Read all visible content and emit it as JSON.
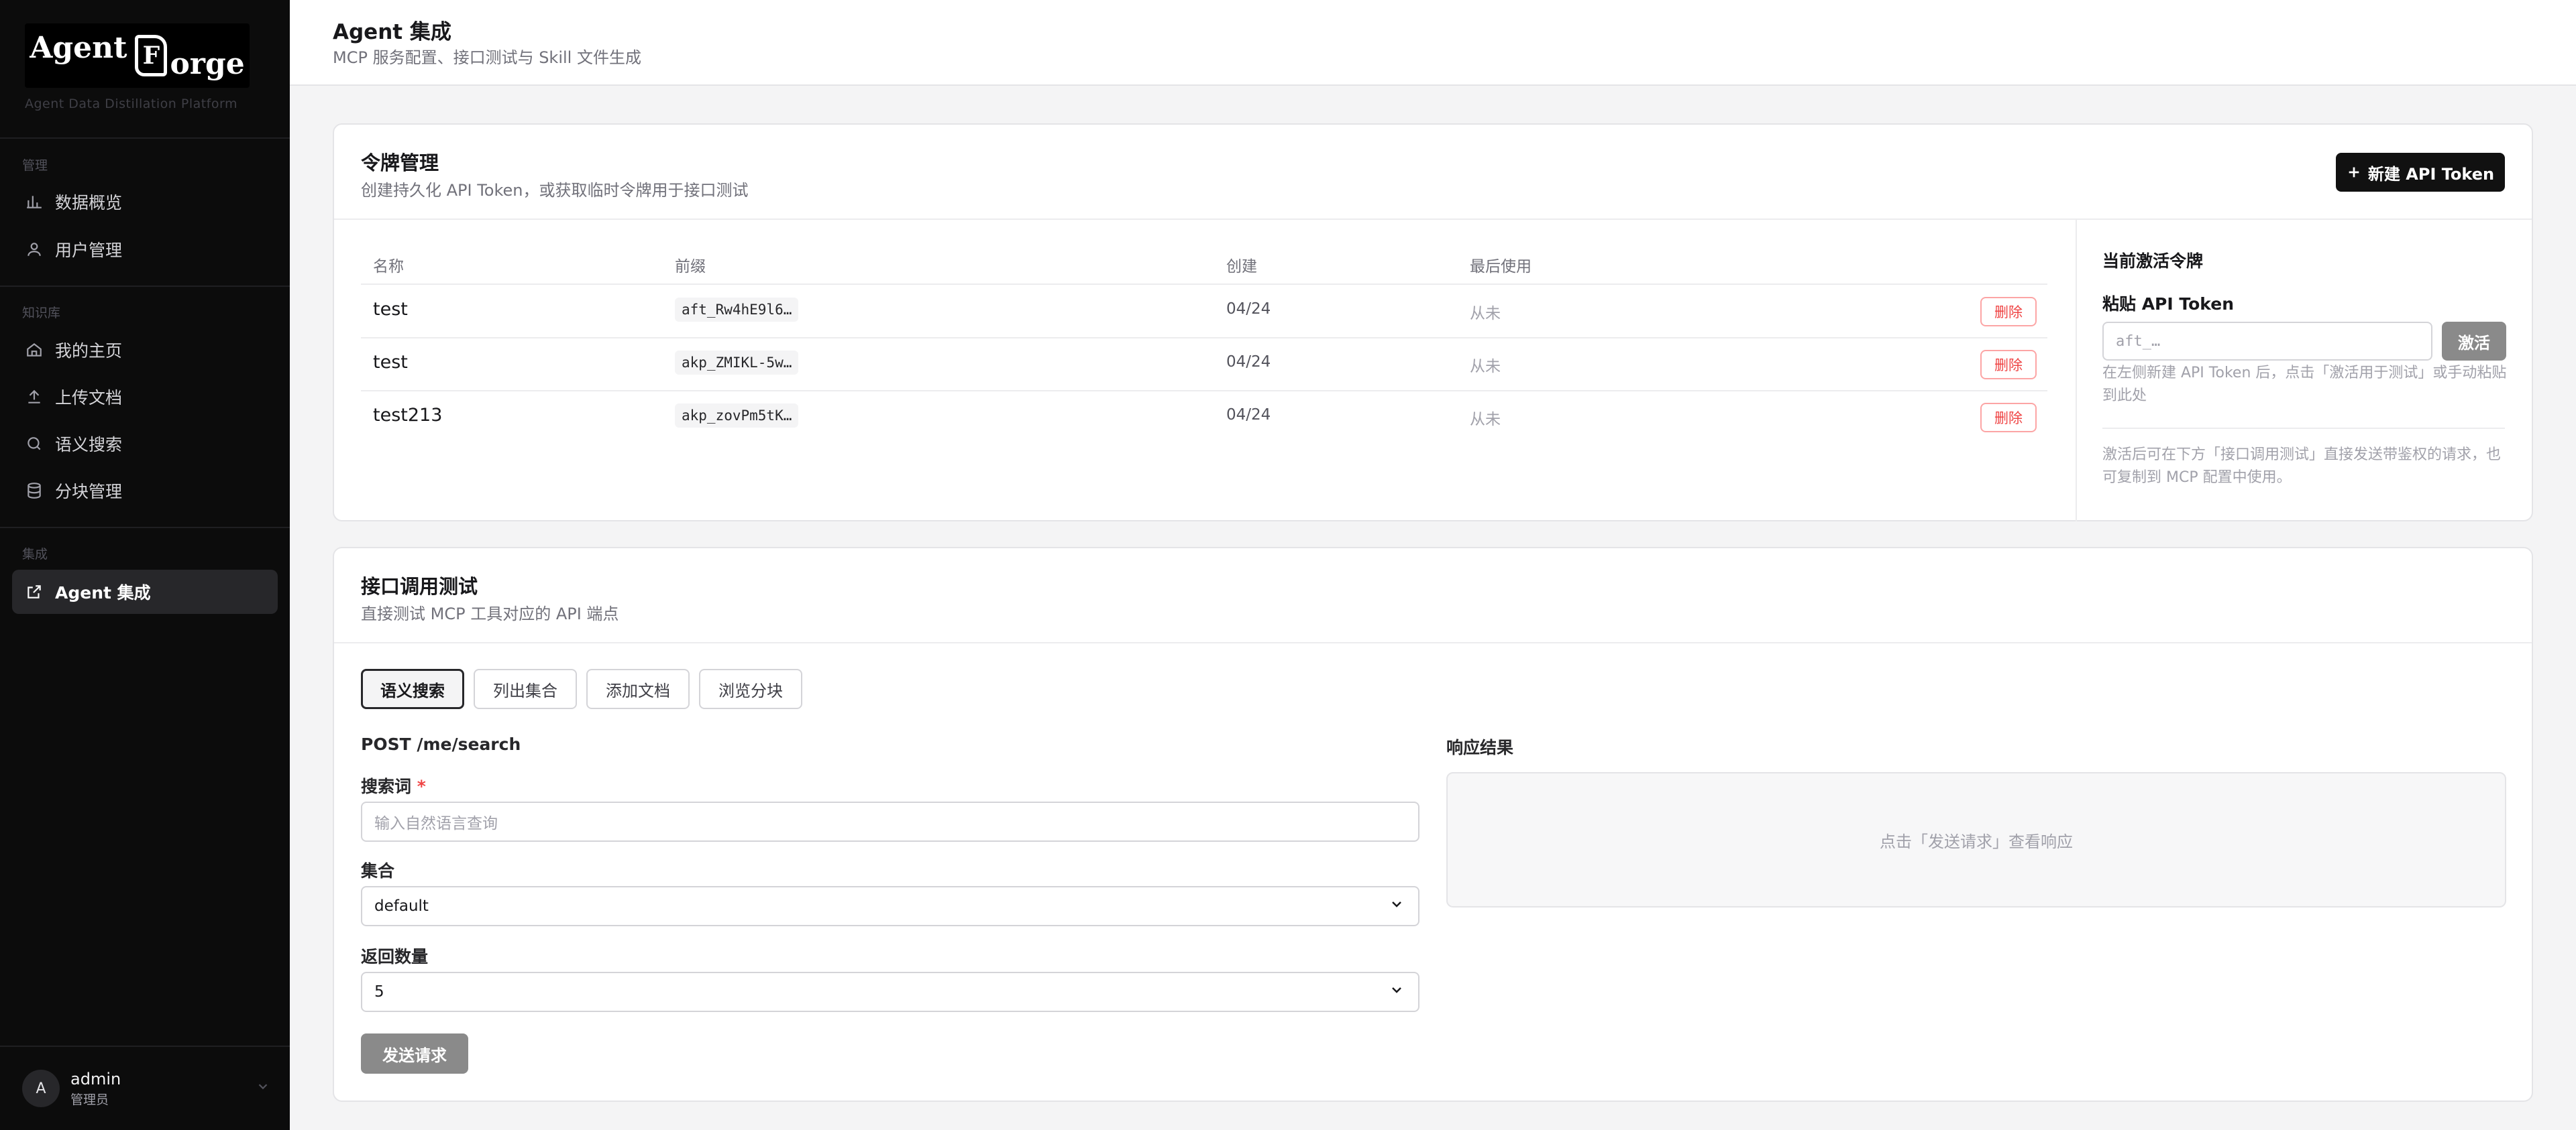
{
  "sidebar": {
    "logo": {
      "word1": "Agent",
      "glyph": "F",
      "word2": "orge"
    },
    "platform": "Agent Data Distillation Platform",
    "sections": {
      "manage": "管理",
      "knowledge": "知识库",
      "integration": "集成"
    },
    "items": {
      "overview": "数据概览",
      "users": "用户管理",
      "home": "我的主页",
      "upload": "上传文档",
      "search": "语义搜索",
      "chunks": "分块管理",
      "agent": "Agent 集成"
    },
    "user": {
      "initial": "A",
      "name": "admin",
      "role": "管理员"
    }
  },
  "header": {
    "title": "Agent 集成",
    "subtitle": "MCP 服务配置、接口测试与 Skill 文件生成"
  },
  "tokens": {
    "title": "令牌管理",
    "subtitle": "创建持久化 API Token，或获取临时令牌用于接口测试",
    "new_button": "新建 API Token",
    "columns": {
      "name": "名称",
      "prefix": "前缀",
      "created": "创建",
      "last_used": "最后使用"
    },
    "rows": [
      {
        "name": "test",
        "prefix": "aft_Rw4hE9l6…",
        "created": "04/24",
        "last_used": "从未",
        "delete": "删除"
      },
      {
        "name": "test",
        "prefix": "akp_ZMIKL-5w…",
        "created": "04/24",
        "last_used": "从未",
        "delete": "删除"
      },
      {
        "name": "test213",
        "prefix": "akp_zovPm5tK…",
        "created": "04/24",
        "last_used": "从未",
        "delete": "删除"
      }
    ],
    "active": {
      "title": "当前激活令牌",
      "paste_label": "粘贴 API Token",
      "placeholder": "aft_…",
      "activate": "激活",
      "hint1": "在左侧新建 API Token 后，点击「激活用于测试」或手动粘贴到此处",
      "hint2": "激活后可在下方「接口调用测试」直接发送带鉴权的请求，也可复制到 MCP 配置中使用。"
    }
  },
  "test": {
    "title": "接口调用测试",
    "subtitle": "直接测试 MCP 工具对应的 API 端点",
    "tabs": [
      "语义搜索",
      "列出集合",
      "添加文档",
      "浏览分块"
    ],
    "endpoint": "POST /me/search",
    "query_label": "搜索词",
    "required_mark": "*",
    "query_placeholder": "输入自然语言查询",
    "collection_label": "集合",
    "collection_value": "default",
    "count_label": "返回数量",
    "count_value": "5",
    "send": "发送请求",
    "response_label": "响应结果",
    "response_placeholder": "点击「发送请求」查看响应"
  }
}
